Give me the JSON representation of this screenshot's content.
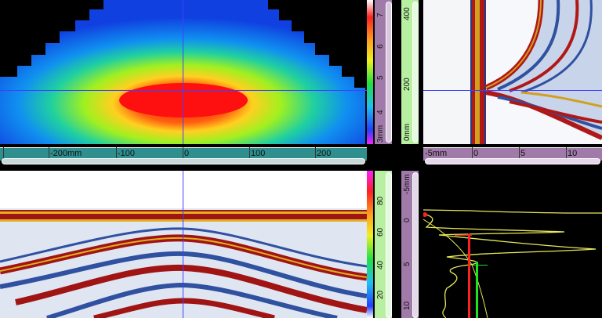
{
  "colors": {
    "teal_scale": "#2f8f8f",
    "purple_scale": "#a07aa8",
    "green_scale": "#b6f0a0",
    "cursor": "#4040ff",
    "ascan_line": "#e8e85a",
    "gate_red": "#ff2020",
    "gate_green": "#20e020"
  },
  "cscan": {
    "x_scale": {
      "labels": [
        "-200mm",
        "-100",
        "0",
        "100",
        "200"
      ]
    },
    "y_scale": {
      "labels": [
        "3mm",
        "4",
        "5",
        "6",
        "7"
      ]
    }
  },
  "dscan": {
    "y_scale": {
      "labels": [
        "0mm",
        "200",
        "400"
      ]
    },
    "x_scale": {
      "labels": [
        "-5mm",
        "0",
        "5",
        "10"
      ]
    }
  },
  "bscan": {
    "amp_scale": {
      "labels": [
        "20",
        "40",
        "60",
        "80"
      ]
    }
  },
  "ascan": {
    "depth_scale": {
      "labels": [
        "-5mm",
        "0",
        "5",
        "10"
      ]
    }
  }
}
